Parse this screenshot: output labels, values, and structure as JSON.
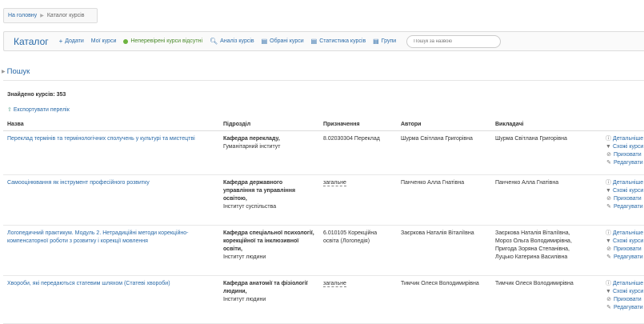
{
  "breadcrumb": {
    "home": "На головну",
    "current": "Каталог курсів"
  },
  "toolbar": {
    "brand": "Каталог",
    "add": "Додати",
    "my_courses": "Мої курси",
    "unverified": "Неперевірені курси відсутні",
    "analysis": "Аналіз курсів",
    "favorites": "Обрані курси",
    "stats": "Статистика курсів",
    "groups": "Групи",
    "search_placeholder": "Пошук за назвою"
  },
  "search_section": {
    "title": "Пошук"
  },
  "results": {
    "found": "Знайдено курсів: 353",
    "export": "Експортувати перелік"
  },
  "columns": [
    "Назва",
    "Підрозділ",
    "Призначення",
    "Автори",
    "Викладачі"
  ],
  "actions": [
    "Детальніше",
    "Схожі курси",
    "Приховати",
    "Редагувати"
  ],
  "rows": [
    {
      "name": "Переклад термінів та термінологічних сполучень у культурі та мистецтві",
      "dept": "Кафедра перекладу,",
      "inst": "Гуманітарний інститут",
      "purpose": "8.02030304 Переклад",
      "authors": "Шурма Світлана Григорівна",
      "teachers": [
        "Шурма Світлана Григорівна"
      ]
    },
    {
      "name": "Самооцінювання як інструмент професійного розвитку",
      "dept": "Кафедра державного управління та управління освітою,",
      "inst": "Інститут суспільства",
      "purpose": "загальне",
      "authors": "Панченко Алла Гнатівна",
      "teachers": [
        "Панченко Алла Гнатівна"
      ]
    },
    {
      "name": "Логопедичний практикум. Модуль 2. Нетрадиційні методи корекційно-компенсаторної роботи з розвитку і корекції мовлення",
      "dept": "Кафедра спеціальної психології, корекційної та інклюзивної освіти,",
      "inst": "Інститут людини",
      "purpose": "6.010105 Корекційна освіта (Логопедія)",
      "authors": "Заєркова Наталія Віталіївна",
      "teachers": [
        "Заєркова Наталія Віталіївна,",
        "Мороз Ольга Володимирівна,",
        "Пригода Зоряна Степанівна,",
        "Луцько Катерина Василівна"
      ]
    },
    {
      "name": "Хвороби, які передаються статевим шляхом (Статеві хвороби)",
      "dept": "Кафедра анатомії та фізіології людини,",
      "inst": "Інститут людини",
      "purpose": "загальне",
      "authors": "Тимчик Олеся Володимирівна",
      "teachers": [
        "Тимчик Олеся Володимирівна"
      ]
    }
  ]
}
